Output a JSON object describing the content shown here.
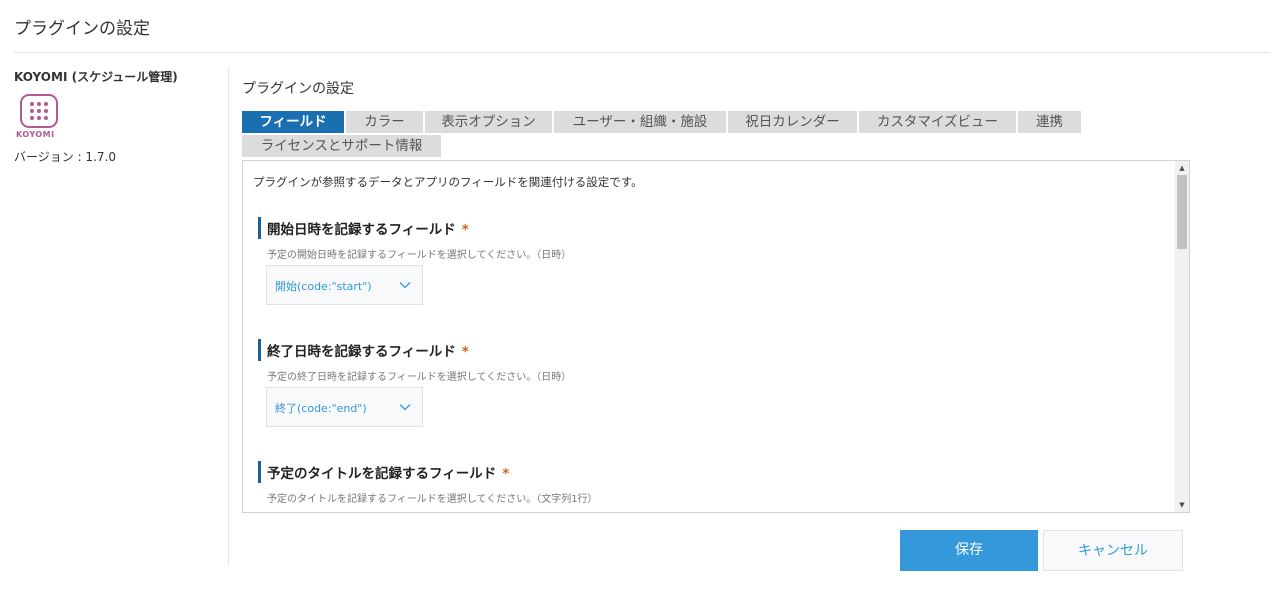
{
  "header": {
    "title": "プラグインの設定"
  },
  "sidebar": {
    "app_name": "KOYOMI (スケジュール管理)",
    "logo_text": "KOYOMI",
    "version": "バージョン : 1.7.0"
  },
  "main": {
    "title": "プラグインの設定",
    "tabs": [
      {
        "label": "フィールド",
        "active": true
      },
      {
        "label": "カラー",
        "active": false
      },
      {
        "label": "表示オプション",
        "active": false
      },
      {
        "label": "ユーザー・組織・施設",
        "active": false
      },
      {
        "label": "祝日カレンダー",
        "active": false
      },
      {
        "label": "カスタマイズビュー",
        "active": false
      },
      {
        "label": "連携",
        "active": false
      },
      {
        "label": "ライセンスとサポート情報",
        "active": false
      }
    ],
    "description": "プラグインが参照するデータとアプリのフィールドを関連付ける設定です。",
    "sections": [
      {
        "title": "開始日時を記録するフィールド",
        "required": "*",
        "help": "予定の開始日時を記録するフィールドを選択してください。（日時）",
        "selected": "開始(code:\"start\")"
      },
      {
        "title": "終了日時を記録するフィールド",
        "required": "*",
        "help": "予定の終了日時を記録するフィールドを選択してください。（日時）",
        "selected": "終了(code:\"end\")"
      },
      {
        "title": "予定のタイトルを記録するフィールド",
        "required": "*",
        "help": "予定のタイトルを記録するフィールドを選択してください。（文字列1行）"
      }
    ]
  },
  "buttons": {
    "save": "保存",
    "cancel": "キャンセル"
  },
  "colors": {
    "accent": "#3498db",
    "tab_active": "#1a6fb0",
    "brand": "#b35a92",
    "required": "#d2621b"
  }
}
